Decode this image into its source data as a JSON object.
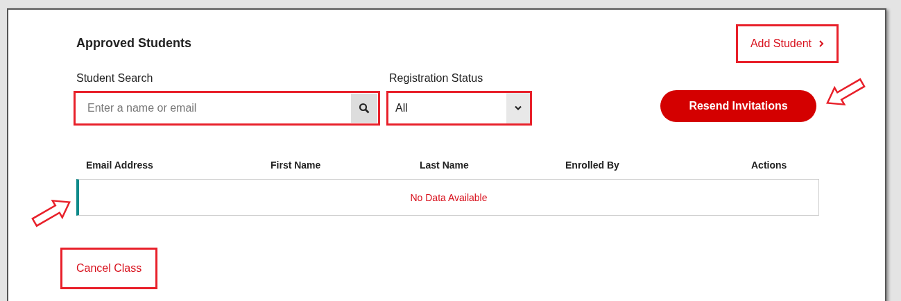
{
  "title": "Approved Students",
  "add_student": {
    "label": "Add Student",
    "highlighted": true
  },
  "search": {
    "label": "Student Search",
    "placeholder": "Enter a name or email",
    "highlighted": true
  },
  "status": {
    "label": "Registration Status",
    "value": "All",
    "highlighted": true
  },
  "resend_button": {
    "label": "Resend Invitations"
  },
  "table": {
    "columns": [
      "Email Address",
      "First Name",
      "Last Name",
      "Enrolled By",
      "Actions"
    ],
    "empty_message": "No Data Available"
  },
  "cancel_class": {
    "label": "Cancel Class",
    "highlighted": true
  }
}
